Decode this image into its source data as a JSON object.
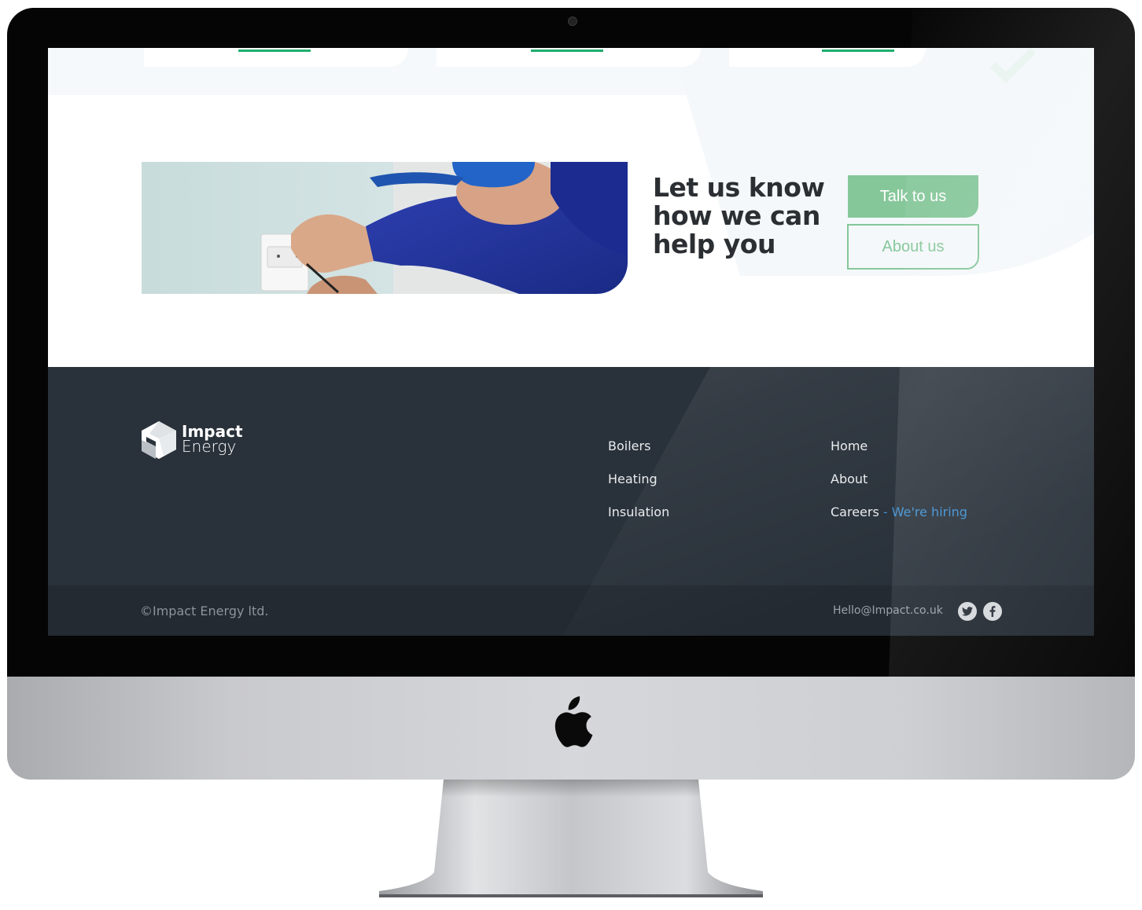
{
  "cta": {
    "title_line1": "Let us know",
    "title_line2": "how we can",
    "title_line3": "help you",
    "talk_button": "Talk to us",
    "about_button": "About us"
  },
  "footer": {
    "brand_line1": "Impact",
    "brand_line2": "Energy",
    "services": [
      "Boilers",
      "Heating",
      "Insulation"
    ],
    "company": {
      "home": "Home",
      "about": "About",
      "careers": "Careers",
      "separator": " - ",
      "hiring": "We're hiring"
    },
    "copyright": "©Impact Energy ltd.",
    "email": "Hello@Impact.co.uk"
  },
  "colors": {
    "accent_green": "#86c79a",
    "footer_bg": "#29313a",
    "link_blue": "#3d8fd1"
  },
  "icons": [
    "twitter-icon",
    "facebook-icon",
    "apple-logo-icon",
    "impact-energy-logo-icon",
    "webcam-icon"
  ]
}
